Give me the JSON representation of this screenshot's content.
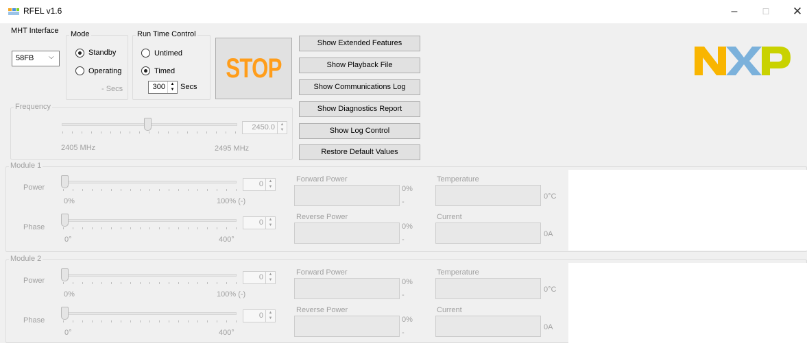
{
  "window": {
    "title": "RFEL v1.6",
    "icon": "app-icon",
    "minimize": "–",
    "maximize": "☐",
    "close": "✕"
  },
  "mht": {
    "label": "MHT Interface",
    "selected": "58FB"
  },
  "mode": {
    "title": "Mode",
    "standby": "Standby",
    "operating": "Operating",
    "secs": "- Secs",
    "selected": "Standby"
  },
  "runtime": {
    "title": "Run Time Control",
    "untimed": "Untimed",
    "timed": "Timed",
    "value": "300",
    "secs": "Secs",
    "selected": "Timed"
  },
  "stop": {
    "label": "STOP",
    "color": "#ff9d1a"
  },
  "buttons": {
    "extended": "Show Extended Features",
    "playback": "Show Playback File",
    "commlog": "Show Communications Log",
    "diagnostics": "Show Diagnostics Report",
    "logcontrol": "Show Log Control",
    "restore": "Restore Default Values"
  },
  "frequency": {
    "title": "Frequency",
    "value": "2450.0",
    "min": "2405 MHz",
    "max": "2495 MHz",
    "level": 0.5
  },
  "module1": {
    "title": "Module 1",
    "power": {
      "label": "Power",
      "value": "0",
      "min": "0%",
      "max": "100% (-)"
    },
    "phase": {
      "label": "Phase",
      "value": "0",
      "min": "0°",
      "max": "400°"
    },
    "forward": {
      "label": "Forward Power",
      "unit": "0%",
      "sub": "-"
    },
    "reverse": {
      "label": "Reverse Power",
      "unit": "0%",
      "sub": "-"
    },
    "temperature": {
      "label": "Temperature",
      "unit": "0°C"
    },
    "current": {
      "label": "Current",
      "unit": "0A"
    }
  },
  "module2": {
    "title": "Module 2",
    "power": {
      "label": "Power",
      "value": "0",
      "min": "0%",
      "max": "100% (-)"
    },
    "phase": {
      "label": "Phase",
      "value": "0",
      "min": "0°",
      "max": "400°"
    },
    "forward": {
      "label": "Forward Power",
      "unit": "0%",
      "sub": "-"
    },
    "reverse": {
      "label": "Reverse Power",
      "unit": "0%",
      "sub": "-"
    },
    "temperature": {
      "label": "Temperature",
      "unit": "0°C"
    },
    "current": {
      "label": "Current",
      "unit": "0A"
    }
  },
  "logo": {
    "text": "NXP",
    "colors": [
      "#f9b500",
      "#7bb1db",
      "#c9d200"
    ]
  }
}
